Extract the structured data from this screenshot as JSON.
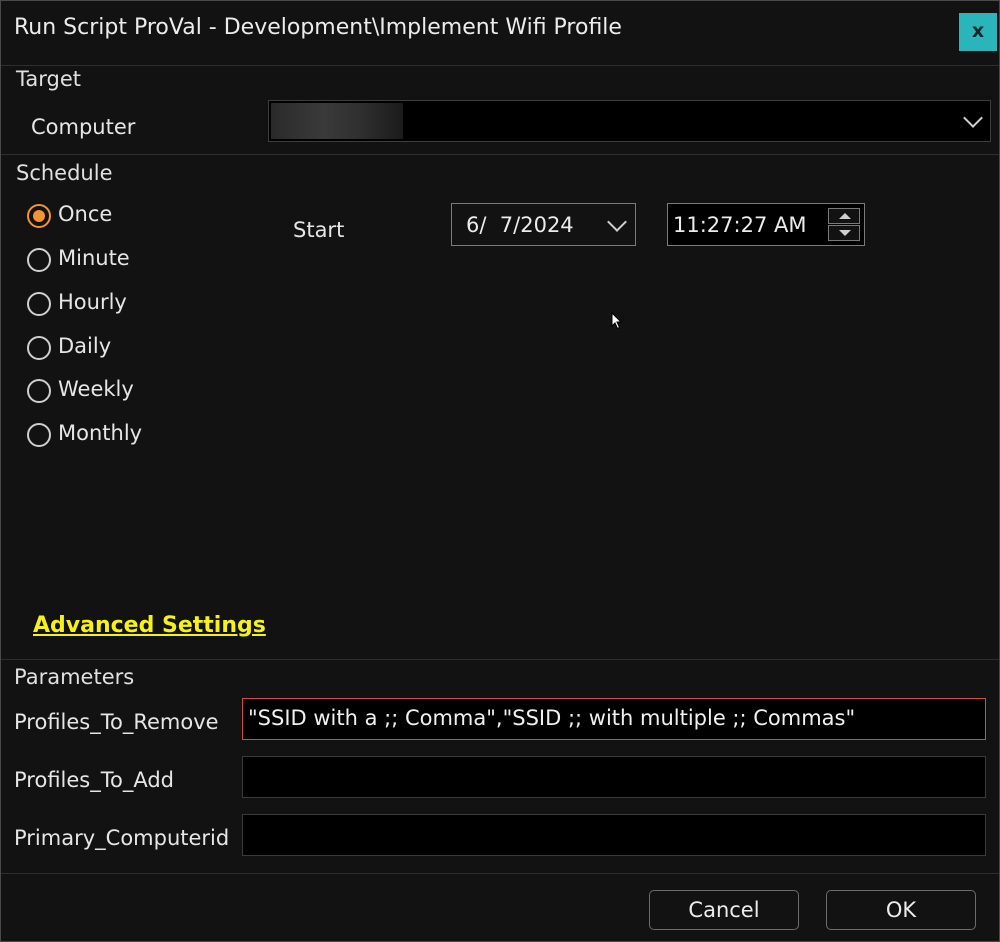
{
  "window": {
    "title": "Run Script ProVal - Development\\Implement Wifi Profile",
    "close_label": "x"
  },
  "target": {
    "section_label": "Target",
    "computer_label": "Computer",
    "computer_value": ""
  },
  "schedule": {
    "section_label": "Schedule",
    "options": [
      "Once",
      "Minute",
      "Hourly",
      "Daily",
      "Weekly",
      "Monthly"
    ],
    "selected": "Once",
    "start_label": "Start",
    "date_value": "6/  7/2024",
    "time_value": "11:27:27 AM",
    "advanced_link": "Advanced Settings"
  },
  "parameters": {
    "section_label": "Parameters",
    "fields": [
      {
        "label": "Profiles_To_Remove",
        "value": "\"SSID with a ;; Comma\",\"SSID ;; with multiple ;; Commas\""
      },
      {
        "label": "Profiles_To_Add",
        "value": ""
      },
      {
        "label": "Primary_Computerid",
        "value": ""
      }
    ]
  },
  "buttons": {
    "cancel": "Cancel",
    "ok": "OK"
  },
  "colors": {
    "accent_radio": "#f29434",
    "close_bg": "#2ab5ba",
    "link": "#f5f21b",
    "active_border": "#d24a4a"
  }
}
